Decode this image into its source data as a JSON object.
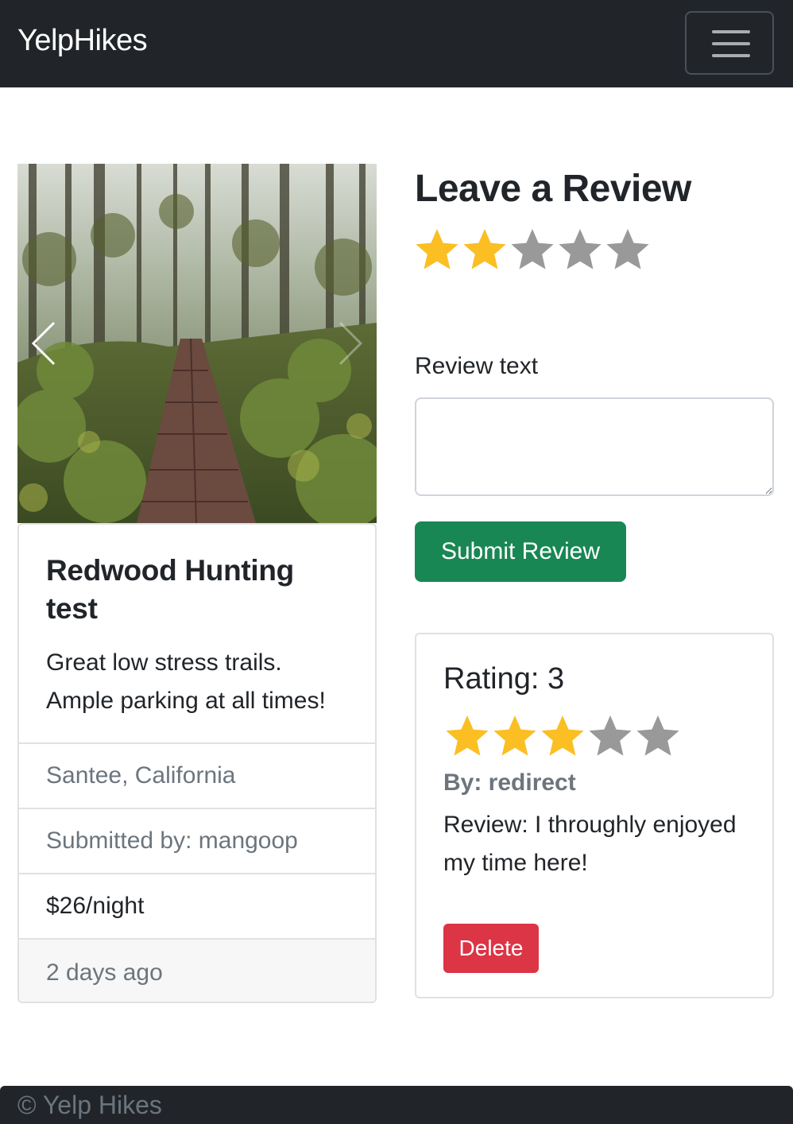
{
  "navbar": {
    "brand": "YelpHikes",
    "toggler_icon": "hamburger-menu-icon"
  },
  "campground": {
    "image_icons": {
      "prev": "chevron-left-icon",
      "next": "chevron-right-icon"
    },
    "title": "Redwood Hunting test",
    "description": "Great low stress trails. Ample parking at all times!",
    "location": "Santee, California",
    "submitted_by": "Submitted by: mangoop",
    "price": "$26/night",
    "posted": "2 days ago"
  },
  "review_form": {
    "title": "Leave a Review",
    "selected_rating": 2,
    "max_rating": 5,
    "review_label": "Review text",
    "review_value": "",
    "submit_label": "Submit Review"
  },
  "reviews": [
    {
      "rating_label": "Rating: 3",
      "rating": 3,
      "author": "By: redirect",
      "text": "Review: I throughly enjoyed my time here!",
      "delete_label": "Delete"
    }
  ],
  "footer": {
    "text": "© Yelp Hikes"
  },
  "colors": {
    "navbar_bg": "#212529",
    "star_filled": "#fbbf24",
    "star_empty": "#999999",
    "submit_green": "#198754",
    "delete_red": "#dc3545"
  }
}
